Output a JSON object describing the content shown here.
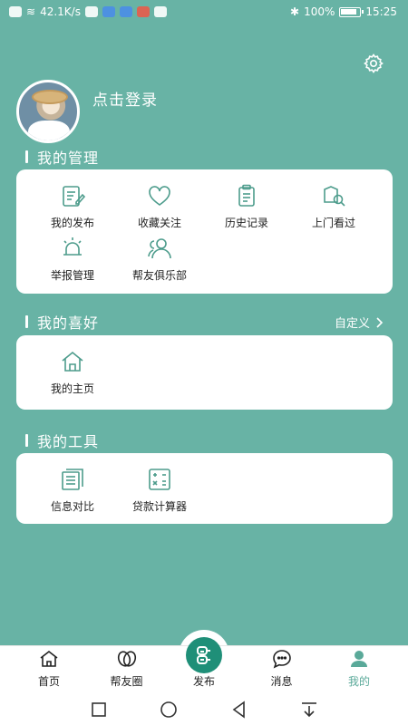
{
  "status_bar": {
    "network_speed": "42.1K/s",
    "battery": "100%",
    "time": "15:25"
  },
  "profile": {
    "login_text": "点击登录"
  },
  "sections": {
    "management": {
      "title": "我的管理",
      "items": [
        {
          "label": "我的发布",
          "icon": "edit-doc-icon"
        },
        {
          "label": "收藏关注",
          "icon": "heart-icon"
        },
        {
          "label": "历史记录",
          "icon": "clipboard-icon"
        },
        {
          "label": "上门看过",
          "icon": "house-search-icon"
        },
        {
          "label": "举报管理",
          "icon": "alarm-icon"
        },
        {
          "label": "帮友俱乐部",
          "icon": "people-icon"
        }
      ]
    },
    "preferences": {
      "title": "我的喜好",
      "action": "自定义",
      "items": [
        {
          "label": "我的主页",
          "icon": "home-icon"
        }
      ]
    },
    "tools": {
      "title": "我的工具",
      "items": [
        {
          "label": "信息对比",
          "icon": "compare-docs-icon"
        },
        {
          "label": "贷款计算器",
          "icon": "calculator-icon"
        }
      ]
    }
  },
  "tabbar": {
    "items": [
      {
        "label": "首页",
        "icon": "home-icon"
      },
      {
        "label": "帮友圈",
        "icon": "circles-icon"
      },
      {
        "label": "发布",
        "icon": "publish-icon"
      },
      {
        "label": "消息",
        "icon": "chat-icon"
      },
      {
        "label": "我的",
        "icon": "user-icon",
        "active": true
      }
    ]
  },
  "colors": {
    "background": "#68b3a5",
    "accent": "#5aa999",
    "icon_stroke": "#4d9c8c",
    "publish": "#1f8f78"
  }
}
